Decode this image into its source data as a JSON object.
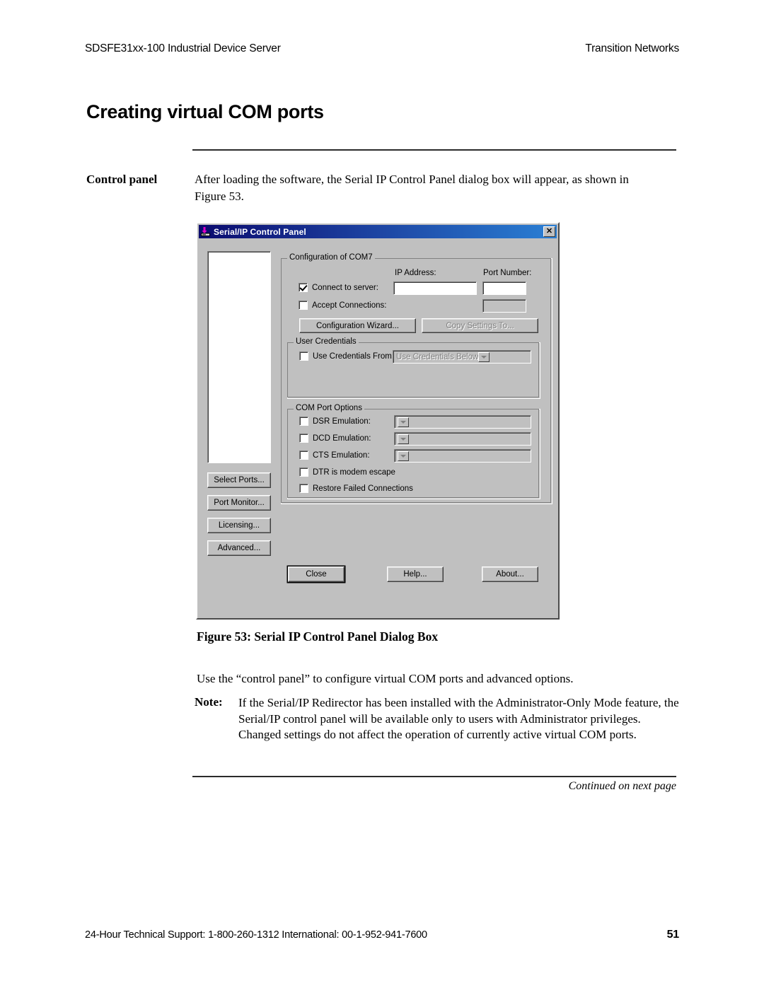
{
  "page": {
    "header_left": "SDSFE31xx-100 Industrial Device Server",
    "header_right": "Transition Networks",
    "title": "Creating virtual COM ports",
    "side_label": "Control panel",
    "intro": "After loading the software, the Serial IP Control Panel dialog box will appear, as shown in Figure 53.",
    "figure_caption": "Figure 53:  Serial IP Control Panel Dialog Box",
    "body_line": "Use the “control panel” to configure virtual COM ports and advanced options.",
    "note_label": "Note:",
    "note_body": "If the Serial/IP Redirector has been installed with the Administrator-Only Mode feature, the Serial/IP control panel will be available only to users with Administrator privileges. Changed settings do not affect the operation of currently active virtual COM ports.",
    "continued": "Continued on next page",
    "footer_left": "24-Hour Technical Support:  1-800-260-1312  International: 00-1-952-941-7600",
    "footer_page": "51"
  },
  "dialog": {
    "title": "Serial/IP Control Panel",
    "title_icon": "redirector-download-icon",
    "close_label": "✕",
    "titlebar_color": "#0a0a6e",
    "face_color": "#c0c0c0",
    "ports_list": [],
    "config_group": {
      "label": "Configuration of COM7",
      "ip_address_label": "IP Address:",
      "port_number_label": "Port Number:",
      "connect_to_server": {
        "label": "Connect to server:",
        "checked": true,
        "ip_value": "",
        "port_value": ""
      },
      "accept_connections": {
        "label": "Accept Connections:",
        "checked": false,
        "port_value": "",
        "disabled": true
      },
      "config_wizard_button": "Configuration Wizard...",
      "copy_settings_button": "Copy Settings To...",
      "copy_settings_disabled": true
    },
    "user_credentials_group": {
      "label": "User Credentials",
      "use_credentials_from": {
        "label": "Use Credentials From:",
        "checked": false
      },
      "credentials_select_value": "Use Credentials Below",
      "credentials_select_disabled": true
    },
    "com_port_options_group": {
      "label": "COM Port Options",
      "rows": [
        {
          "label": "DSR Emulation:",
          "checked": false,
          "has_combo": true,
          "combo_value": "",
          "combo_disabled": true
        },
        {
          "label": "DCD Emulation:",
          "checked": false,
          "has_combo": true,
          "combo_value": "",
          "combo_disabled": true
        },
        {
          "label": "CTS Emulation:",
          "checked": false,
          "has_combo": true,
          "combo_value": "",
          "combo_disabled": true
        },
        {
          "label": "DTR is modem escape",
          "checked": false,
          "has_combo": false
        },
        {
          "label": "Restore Failed Connections",
          "checked": false,
          "has_combo": false
        }
      ]
    },
    "side_buttons": [
      "Select Ports...",
      "Port Monitor...",
      "Licensing...",
      "Advanced..."
    ],
    "bottom_buttons": [
      {
        "label": "Close",
        "default": true
      },
      {
        "label": "Help...",
        "default": false
      },
      {
        "label": "About...",
        "default": false
      }
    ]
  }
}
